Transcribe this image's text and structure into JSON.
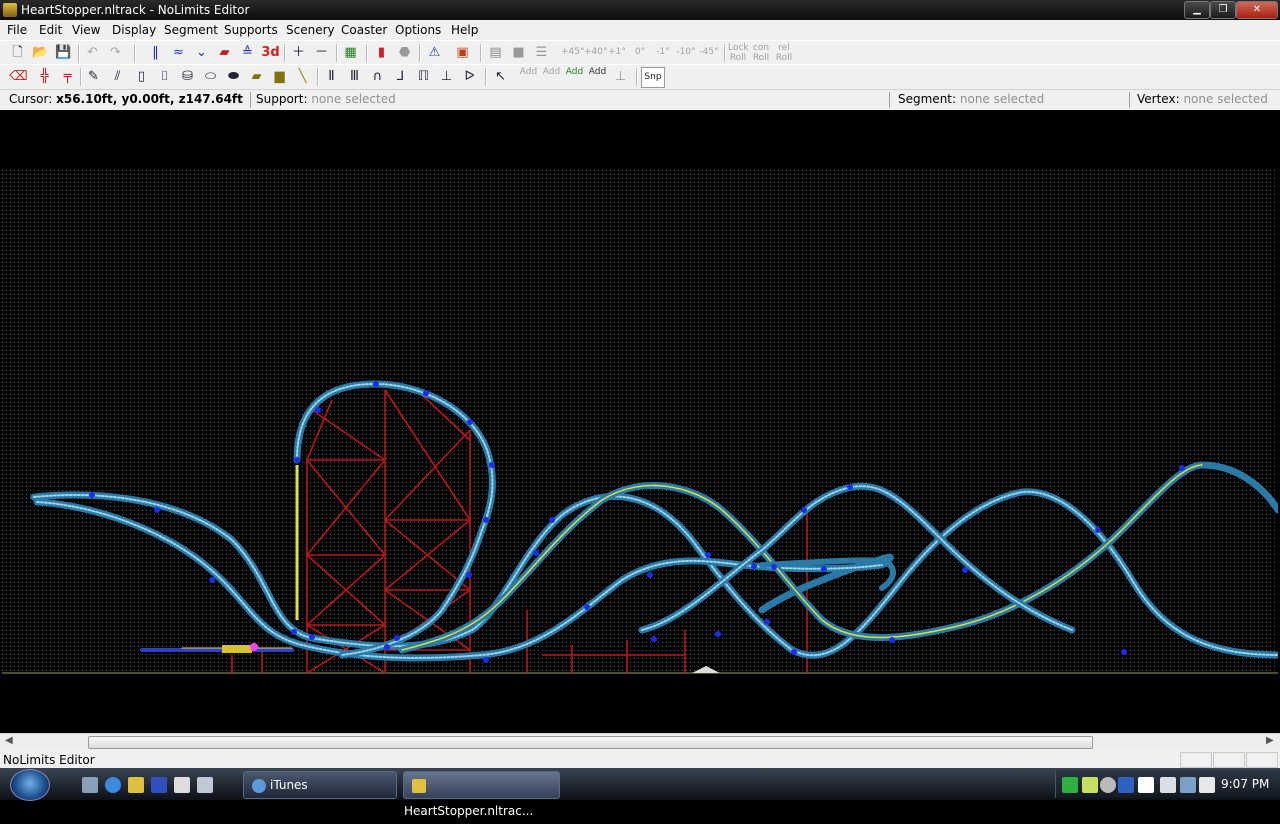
{
  "window": {
    "title": "HeartStopper.nltrack - NoLimits Editor",
    "min": "▁",
    "max": "❐",
    "close": "✕"
  },
  "menu": [
    "File",
    "Edit",
    "View",
    "Display",
    "Segment",
    "Supports",
    "Scenery",
    "Coaster",
    "Options",
    "Help"
  ],
  "toolbar1": {
    "pos_angles": [
      "+45°",
      "+40°",
      "+1°",
      "0°",
      "-1°",
      "-10°",
      "-45°"
    ],
    "lock_roll": "Lock Roll",
    "con_roll": "con Roll",
    "rel_roll": "rel Roll"
  },
  "toolbar2": {
    "add_labels": [
      "Add",
      "Add",
      "Add",
      "Add"
    ],
    "snap": "Snp"
  },
  "status": {
    "cursor_label": "Cursor:",
    "cursor_value": "x56.10ft, y0.00ft, z147.64ft",
    "support_label": "Support:",
    "support_value": "none selected",
    "segment_label": "Segment:",
    "segment_value": "none selected",
    "vertex_label": "Vertex:",
    "vertex_value": "none selected"
  },
  "bottom_status": "NoLimits Editor",
  "taskbar": {
    "tasks": [
      {
        "label": "iTunes"
      },
      {
        "label": "HeartStopper.nltrac..."
      }
    ],
    "clock": "9:07 PM"
  },
  "colors": {
    "track": "#3ab0d8",
    "rail": "#d8e040",
    "support": "#c01818",
    "node": "#1a2cf0",
    "grid": "#4a4a4a"
  }
}
